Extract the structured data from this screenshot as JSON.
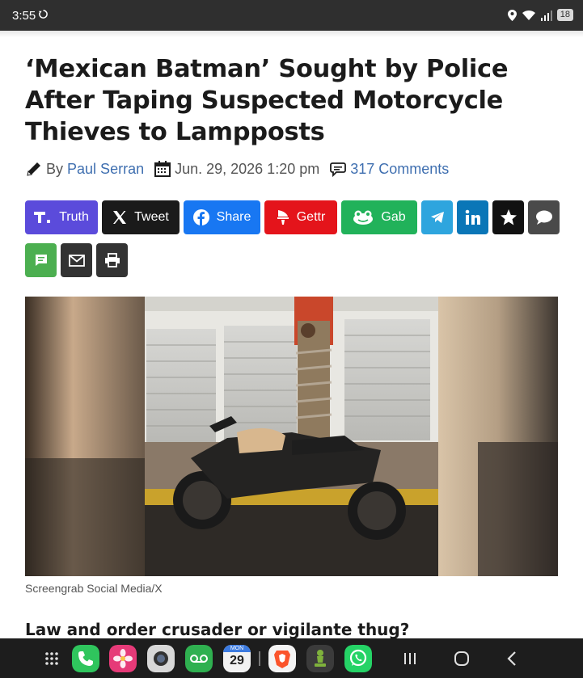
{
  "status_bar": {
    "time": "3:55",
    "battery": "18"
  },
  "article": {
    "headline": "‘Mexican Batman’ Sought by Police After Taping Suspected Motorcycle Thieves to Lampposts",
    "byline": {
      "by_prefix": "By",
      "author": "Paul Serran",
      "date": "Jun. 29, 2026 1:20 pm",
      "comments": "317 Comments"
    },
    "image_caption": "Screengrab Social Media/X",
    "subheading": "Law and order crusader or vigilante thug?"
  },
  "share_buttons": {
    "truth": "Truth",
    "tweet": "Tweet",
    "share": "Share",
    "gettr": "Gettr",
    "gab": "Gab"
  },
  "colors": {
    "truth": "#5b4bdb",
    "x": "#1a1a1a",
    "facebook": "#1877f2",
    "gettr": "#e4141b",
    "gab": "#21b25a",
    "telegram": "#2ea5de",
    "linkedin": "#0a76b7",
    "parler": "#111111",
    "comment": "#4a4a4a",
    "sms": "#4caf50",
    "email": "#333333",
    "print": "#333333",
    "link": "#3f6fb0"
  },
  "nav_bar": {
    "calendar_day": "29",
    "calendar_month": "MON"
  }
}
